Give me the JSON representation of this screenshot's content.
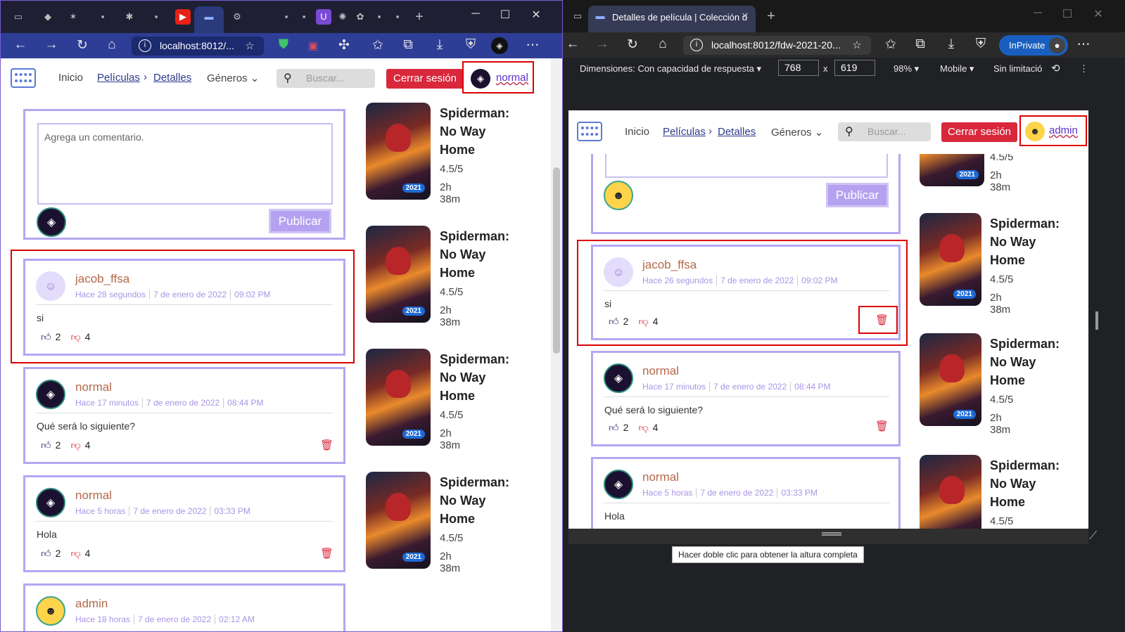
{
  "left": {
    "url": "localhost:8012/...",
    "nav": {
      "inicio": "Inicio",
      "peliculas": "Películas",
      "detalles": "Detalles",
      "generos": "Géneros",
      "search_placeholder": "Buscar...",
      "logout": "Cerrar sesión",
      "username": "normal"
    },
    "composer": {
      "placeholder": "Agrega un comentario.",
      "publish": "Publicar"
    },
    "comments": [
      {
        "name": "jacob_ffsa",
        "ago": "Hace 28 segundos",
        "date": "7 de enero de 2022",
        "time": "09:02 PM",
        "text": "si",
        "likes": "2",
        "dislikes": "4"
      },
      {
        "name": "normal",
        "ago": "Hace 17 minutos",
        "date": "7 de enero de 2022",
        "time": "08:44 PM",
        "text": "Qué será lo siguiente?",
        "likes": "2",
        "dislikes": "4"
      },
      {
        "name": "normal",
        "ago": "Hace 5 horas",
        "date": "7 de enero de 2022",
        "time": "03:33 PM",
        "text": "Hola",
        "likes": "2",
        "dislikes": "4"
      },
      {
        "name": "admin",
        "ago": "Hace 18 horas",
        "date": "7 de enero de 2022",
        "time": "02:12 AM"
      }
    ],
    "movies": [
      {
        "title": "Spiderman: No Way Home",
        "rating": "4.5/5",
        "duration": "2h 38m",
        "year": "2021"
      }
    ]
  },
  "right": {
    "tab_title": "Detalles de película | Colección d",
    "url": "localhost:8012/fdw-2021-20...",
    "inprivate": "InPrivate",
    "devtools": {
      "dimensions": "Dimensiones: Con capacidad de respuesta",
      "width": "768",
      "x": "x",
      "height": "619",
      "zoom": "98%",
      "device": "Mobile",
      "throttle": "Sin limitació"
    },
    "nav": {
      "inicio": "Inicio",
      "peliculas": "Películas",
      "detalles": "Detalles",
      "generos": "Géneros",
      "search_placeholder": "Buscar...",
      "logout": "Cerrar sesión",
      "username": "admin"
    },
    "composer": {
      "publish": "Publicar"
    },
    "comments": [
      {
        "name": "jacob_ffsa",
        "ago": "Hace 26 segundos",
        "date": "7 de enero de 2022",
        "time": "09:02 PM",
        "text": "si",
        "likes": "2",
        "dislikes": "4"
      },
      {
        "name": "normal",
        "ago": "Hace 17 minutos",
        "date": "7 de enero de 2022",
        "time": "08:44 PM",
        "text": "Qué será lo siguiente?",
        "likes": "2",
        "dislikes": "4"
      },
      {
        "name": "normal",
        "ago": "Hace 5 horas",
        "date": "7 de enero de 2022",
        "time": "03:33 PM",
        "text": "Hola"
      }
    ],
    "tooltip": "Hacer doble clic para obtener la altura completa"
  }
}
